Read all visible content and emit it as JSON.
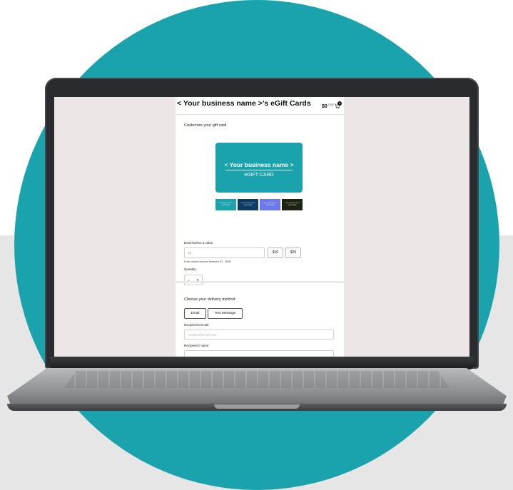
{
  "store": {
    "title": "< Your business name >'s eGift Cards",
    "cart_total": "$0",
    "cart_currency": "CAD",
    "cart_count": "0"
  },
  "customize": {
    "heading": "Customize your gift card",
    "card_name": "< Your business name >",
    "card_type": "eGIFT CARD",
    "card_color": "#1aa3ad",
    "designs": [
      {
        "text": "< Your business name >",
        "sub": "eGIFT CARD",
        "color": "#1aa3ad"
      },
      {
        "text": "< Your business name >",
        "sub": "eGIFT CARD",
        "color": "#0c3c66"
      },
      {
        "text": "< Your business name >",
        "sub": "eGIFT CARD",
        "color": "#6b78ee"
      },
      {
        "text": "< Your business name >",
        "sub": "eGIFT CARD",
        "color": "#1b2410"
      }
    ]
  },
  "value": {
    "label": "Enter/Select a value",
    "placeholder": "10",
    "preset_1": "$10",
    "preset_2": "$25",
    "hint": "Enter whole amount between $1 - $500"
  },
  "quantity": {
    "label": "Quantity",
    "selected": "1"
  },
  "delivery": {
    "heading": "Choose your delivery method",
    "email_tab": "Email",
    "text_tab": "Text Message",
    "recipient_email_label": "Recipient's Email",
    "recipient_email_placeholder": "recipient@email.com",
    "recipient_name_label": "Recipient's name"
  }
}
